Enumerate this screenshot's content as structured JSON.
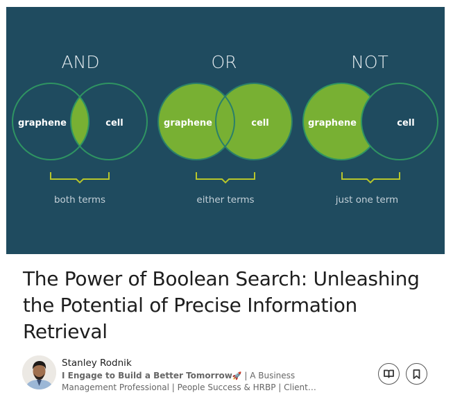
{
  "hero": {
    "background": "#1f4b5f",
    "fill_color": "#78b033",
    "stroke_color": "#2f9462",
    "bracket_color": "#b7c62b",
    "heading_color": "#e6edf1",
    "caption_color": "#c3d0d8",
    "term_color": "#ffffff",
    "diagrams": [
      {
        "operator": "AND",
        "left_term": "graphene",
        "right_term": "cell",
        "caption": "both terms",
        "fill": "intersection"
      },
      {
        "operator": "OR",
        "left_term": "graphene",
        "right_term": "cell",
        "caption": "either terms",
        "fill": "union"
      },
      {
        "operator": "NOT",
        "left_term": "graphene",
        "right_term": "cell",
        "caption": "just one term",
        "fill": "left-only"
      }
    ]
  },
  "article": {
    "title": "The Power of Boolean Search: Unleashing the Potential of Precise Information Retrieval"
  },
  "author": {
    "name": "Stanley Rodnik",
    "headline_bold": "I Engage to Build a Better Tomorrow",
    "headline_emoji": "🚀",
    "headline_rest": " | A Business Management Professional | People Success & HRBP | Client…",
    "avatar_icon": "profile-photo"
  },
  "actions": [
    {
      "name": "read-button",
      "icon": "open-book-icon"
    },
    {
      "name": "save-button",
      "icon": "bookmark-icon"
    }
  ]
}
